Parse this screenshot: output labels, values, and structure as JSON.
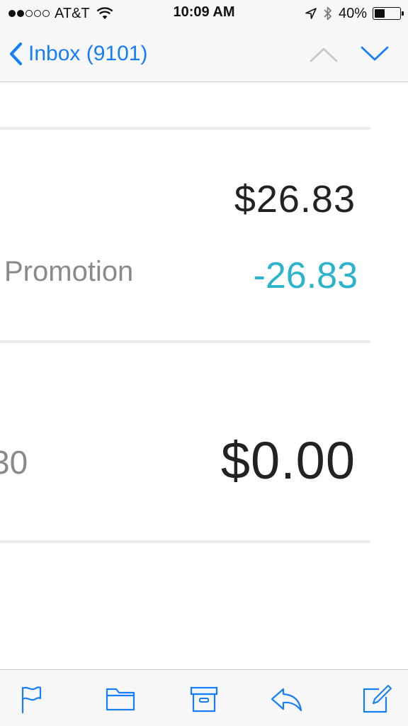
{
  "status_bar": {
    "carrier": "AT&T",
    "time": "10:09 AM",
    "battery_percent": "40%",
    "battery_level": 0.4,
    "signal_bars_filled": 2,
    "signal_bars_total": 5
  },
  "nav": {
    "back_label": "Inbox (9101)",
    "accent_color": "#157efb",
    "icons": [
      "chevron-left-icon",
      "chevron-up-icon",
      "chevron-down-icon"
    ]
  },
  "receipt": {
    "amount_1": "$26.83",
    "promotion_label": "Promotion",
    "promotion_value": "-26.83",
    "promotion_color": "#2bb3d0",
    "partial_label": "30",
    "amount_2": "$0.00"
  },
  "toolbar": {
    "icons": [
      "flag-icon",
      "folder-icon",
      "archive-icon",
      "reply-icon",
      "compose-icon"
    ]
  }
}
